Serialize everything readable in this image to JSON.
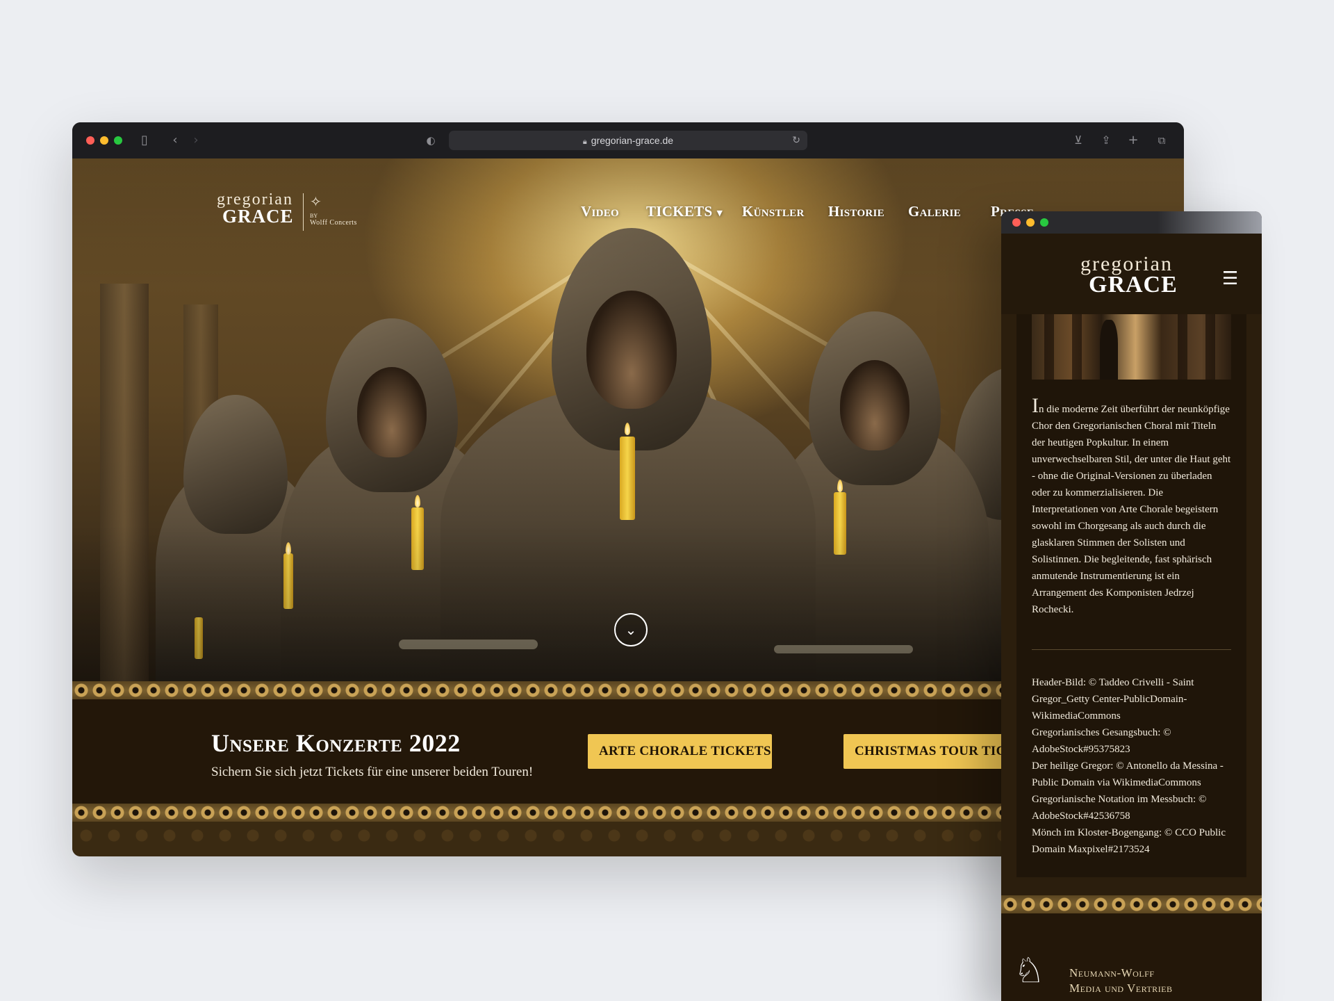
{
  "browser": {
    "url": "gregorian-grace.de",
    "icons": {
      "sidebar": "sidebar-icon",
      "back": "chevron-left-icon",
      "forward": "chevron-right-icon",
      "shield": "shield-icon",
      "lock": "lock-icon",
      "reload": "reload-icon",
      "download": "download-icon",
      "share": "share-icon",
      "new_tab": "plus-icon",
      "tabs": "tabs-overview-icon"
    }
  },
  "site": {
    "logo": {
      "line1": "gregorian",
      "line2": "GRACE",
      "by": "BY",
      "partner": "Wolff Concerts"
    },
    "nav": [
      {
        "label": "Video"
      },
      {
        "label": "TICKETS"
      },
      {
        "label": "Künstler"
      },
      {
        "label": "Historie"
      },
      {
        "label": "Galerie"
      },
      {
        "label": "Presse"
      }
    ],
    "concerts": {
      "title": "Unsere Konzerte 2022",
      "subtitle": "Sichern Sie sich jetzt Tickets für eine unserer beiden Touren!",
      "buttons": [
        {
          "label": "ARTE CHORALE TICKETS"
        },
        {
          "label": "CHRISTMAS TOUR TICKETS"
        }
      ]
    }
  },
  "mobile": {
    "logo": {
      "line1": "gregorian",
      "line2": "GRACE"
    },
    "menu_icon": "hamburger-menu-icon",
    "intro_dropcap": "I",
    "intro_text": "n die moderne Zeit überführt der neunköpfige Chor den Gregorianischen Choral mit Titeln der heutigen Popkultur. In einem unverwechselbaren Stil, der unter die Haut geht - ohne die Original-Versionen zu überladen oder zu kommerzialisieren. Die Interpretationen von Arte Chorale begeistern sowohl im Chorgesang als auch durch die glasklaren Stimmen der Solisten und Solistinnen. Die begleitende, fast sphärisch anmutende Instrumentierung ist ein Arrangement des Komponisten Jedrzej Rochecki.",
    "credits": [
      "Header-Bild: © Taddeo Crivelli - Saint Gregor_Getty Center-PublicDomain-WikimediaCommons",
      "Gregorianisches Gesangsbuch: © AdobeStock#95375823",
      "Der heilige Gregor: © Antonello da Messina - Public Domain via WikimediaCommons",
      "Gregorianische Notation im Messbuch: © AdobeStock#42536758",
      "Mönch im Kloster-Bogengang: © CCO Public Domain Maxpixel#2173524"
    ],
    "footer": {
      "line1": "Neumann-Wolff",
      "line2": "Media und Vertrieb"
    }
  }
}
